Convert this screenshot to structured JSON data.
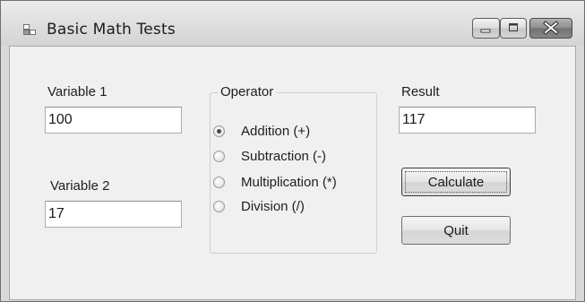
{
  "window": {
    "title": "Basic Math Tests"
  },
  "form": {
    "variable1_label": "Variable 1",
    "variable1_value": "100",
    "variable2_label": "Variable 2",
    "variable2_value": "17",
    "result_label": "Result",
    "result_value": "117"
  },
  "operator_group": {
    "title": "Operator",
    "options": [
      {
        "label": "Addition (+)",
        "checked": true
      },
      {
        "label": "Subtraction (-)",
        "checked": false
      },
      {
        "label": "Multiplication (*)",
        "checked": false
      },
      {
        "label": "Division (/)",
        "checked": false
      }
    ]
  },
  "buttons": {
    "calculate": "Calculate",
    "quit": "Quit"
  },
  "icons": {
    "app": "form-window-icon",
    "minimize": "minimize-icon",
    "maximize": "maximize-icon",
    "close": "close-icon"
  },
  "colors": {
    "window_background": "#f0f0f0",
    "titlebar": "#dedede",
    "close_button": "#8e8e8e"
  }
}
